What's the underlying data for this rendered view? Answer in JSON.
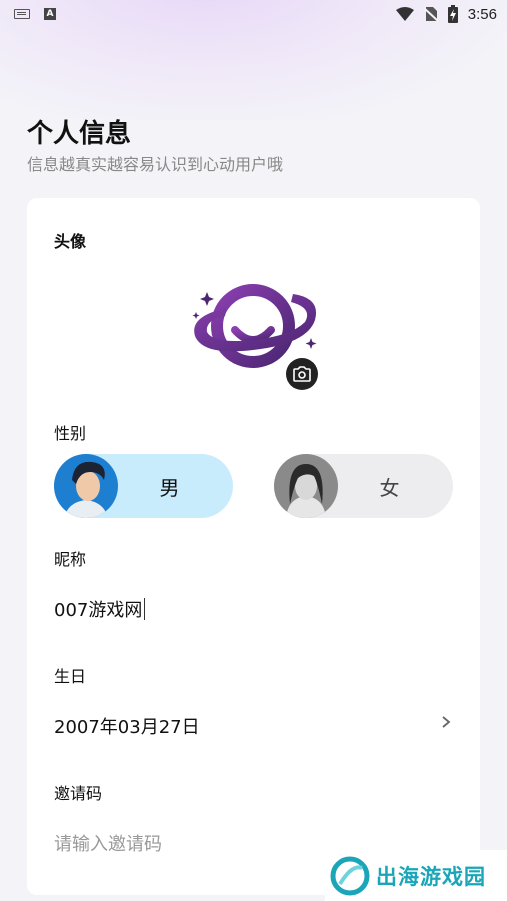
{
  "status_bar": {
    "time": "3:56"
  },
  "header": {
    "title": "个人信息",
    "subtitle": "信息越真实越容易认识到心动用户哦"
  },
  "form": {
    "avatar_label": "头像",
    "gender_label": "性别",
    "gender_options": [
      {
        "label": "男",
        "selected": true
      },
      {
        "label": "女",
        "selected": false
      }
    ],
    "nickname_label": "昵称",
    "nickname_value": "007游戏网",
    "birthday_label": "生日",
    "birthday_value": "2007年03月27日",
    "invite_label": "邀请码",
    "invite_placeholder": "请输入邀请码"
  },
  "watermark": {
    "text": "出海游戏园"
  },
  "colors": {
    "accent_purple": "#6a2f8c",
    "male_pill": "#c8ecfb",
    "female_pill": "#ededf0",
    "watermark": "#1aa6b8"
  }
}
